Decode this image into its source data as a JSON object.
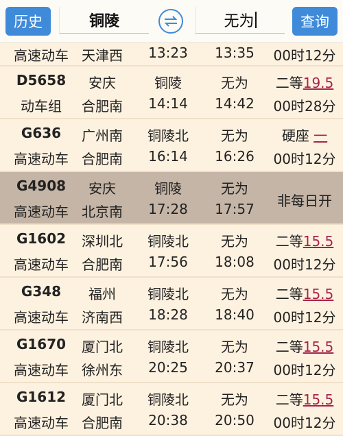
{
  "header": {
    "history_label": "历史",
    "from_station": "铜陵",
    "to_station": "无为",
    "query_label": "查询",
    "swap_icon": "swap-arrows-icon",
    "accent_color": "#3f8ad9"
  },
  "trains": [
    {
      "no": "",
      "type": "高速动车",
      "from": "",
      "from2": "天津西",
      "dep_station": "",
      "dep_time": "13:23",
      "arr_station": "",
      "arr_time": "13:35",
      "seat": "",
      "price": "",
      "duration": "00时12分"
    },
    {
      "no": "D5658",
      "type": "动车组",
      "from": "安庆",
      "from2": "合肥南",
      "dep_station": "铜陵",
      "dep_time": "14:14",
      "arr_station": "无为",
      "arr_time": "14:42",
      "seat": "二等",
      "price": "19.5",
      "duration": "00时28分"
    },
    {
      "no": "G636",
      "type": "高速动车",
      "from": "广州南",
      "from2": "合肥南",
      "dep_station": "铜陵北",
      "dep_time": "16:14",
      "arr_station": "无为",
      "arr_time": "16:26",
      "seat": "硬座",
      "price": "一",
      "duration": "00时12分"
    },
    {
      "no": "G4908",
      "type": "高速动车",
      "from": "安庆",
      "from2": "北京南",
      "dep_station": "铜陵",
      "dep_time": "17:28",
      "arr_station": "无为",
      "arr_time": "17:57",
      "seat": "",
      "price": "",
      "duration": "",
      "note": "非每日开"
    },
    {
      "no": "G1602",
      "type": "高速动车",
      "from": "深圳北",
      "from2": "合肥南",
      "dep_station": "铜陵北",
      "dep_time": "17:56",
      "arr_station": "无为",
      "arr_time": "18:08",
      "seat": "二等",
      "price": "15.5",
      "duration": "00时12分"
    },
    {
      "no": "G348",
      "type": "高速动车",
      "from": "福州",
      "from2": "济南西",
      "dep_station": "铜陵北",
      "dep_time": "18:28",
      "arr_station": "无为",
      "arr_time": "18:40",
      "seat": "二等",
      "price": "15.5",
      "duration": "00时12分"
    },
    {
      "no": "G1670",
      "type": "高速动车",
      "from": "厦门北",
      "from2": "徐州东",
      "dep_station": "铜陵北",
      "dep_time": "20:25",
      "arr_station": "无为",
      "arr_time": "20:37",
      "seat": "二等",
      "price": "15.5",
      "duration": "00时12分"
    },
    {
      "no": "G1612",
      "type": "高速动车",
      "from": "厦门北",
      "from2": "合肥南",
      "dep_station": "铜陵北",
      "dep_time": "20:38",
      "arr_station": "无为",
      "arr_time": "20:50",
      "seat": "二等",
      "price": "15.5",
      "duration": "00时12分"
    }
  ],
  "colors": {
    "row_bg": "#fdf1e0",
    "highlight_bg": "#c4b5a6",
    "price_color": "#a8224a"
  }
}
